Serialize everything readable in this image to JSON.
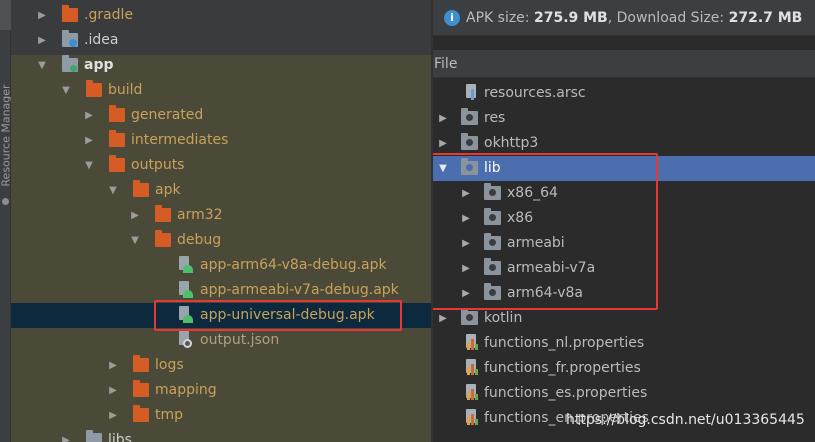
{
  "side_tool": {
    "label": "Resource Manager"
  },
  "project_tree": [
    {
      "label": ".gradle",
      "depth": 1,
      "expanded": false,
      "icon": "folder-icon"
    },
    {
      "label": ".idea",
      "depth": 1,
      "expanded": false,
      "icon": "idea-folder-icon"
    },
    {
      "label": "app",
      "depth": 1,
      "expanded": true,
      "icon": "module-folder-icon"
    },
    {
      "label": "build",
      "depth": 2,
      "expanded": true,
      "icon": "folder-icon"
    },
    {
      "label": "generated",
      "depth": 3,
      "expanded": false,
      "icon": "folder-icon"
    },
    {
      "label": "intermediates",
      "depth": 3,
      "expanded": false,
      "icon": "folder-icon"
    },
    {
      "label": "outputs",
      "depth": 3,
      "expanded": true,
      "icon": "folder-icon"
    },
    {
      "label": "apk",
      "depth": 4,
      "expanded": true,
      "icon": "folder-icon"
    },
    {
      "label": "arm32",
      "depth": 5,
      "expanded": false,
      "icon": "folder-icon"
    },
    {
      "label": "debug",
      "depth": 5,
      "expanded": true,
      "icon": "folder-icon"
    },
    {
      "label": "app-arm64-v8a-debug.apk",
      "depth": 6,
      "icon": "apk-file-icon"
    },
    {
      "label": "app-armeabi-v7a-debug.apk",
      "depth": 6,
      "icon": "apk-file-icon"
    },
    {
      "label": "app-universal-debug.apk",
      "depth": 6,
      "icon": "apk-file-icon",
      "selected": true
    },
    {
      "label": "output.json",
      "depth": 6,
      "icon": "json-file-icon"
    },
    {
      "label": "logs",
      "depth": 4,
      "expanded": false,
      "icon": "folder-icon"
    },
    {
      "label": "mapping",
      "depth": 4,
      "expanded": false,
      "icon": "folder-icon"
    },
    {
      "label": "tmp",
      "depth": 4,
      "expanded": false,
      "icon": "folder-icon"
    },
    {
      "label": "libs",
      "depth": 2,
      "expanded": false,
      "icon": "folder-icon"
    }
  ],
  "apk_analyzer": {
    "apk_size_label": "APK size:",
    "apk_size_value": "275.9 MB",
    "download_size_label": "Download Size:",
    "download_size_value": "272.7 MB",
    "separator": ",",
    "column_header": "File",
    "entries": [
      {
        "label": "resources.arsc",
        "depth": 1,
        "icon": "resource-file-icon"
      },
      {
        "label": "res",
        "depth": 1,
        "expanded": false,
        "icon": "folder-icon"
      },
      {
        "label": "okhttp3",
        "depth": 1,
        "expanded": false,
        "icon": "folder-icon"
      },
      {
        "label": "lib",
        "depth": 1,
        "expanded": true,
        "icon": "folder-icon",
        "selected": true
      },
      {
        "label": "x86_64",
        "depth": 2,
        "expanded": false,
        "icon": "folder-icon"
      },
      {
        "label": "x86",
        "depth": 2,
        "expanded": false,
        "icon": "folder-icon"
      },
      {
        "label": "armeabi",
        "depth": 2,
        "expanded": false,
        "icon": "folder-icon"
      },
      {
        "label": "armeabi-v7a",
        "depth": 2,
        "expanded": false,
        "icon": "folder-icon"
      },
      {
        "label": "arm64-v8a",
        "depth": 2,
        "expanded": false,
        "icon": "folder-icon"
      },
      {
        "label": "kotlin",
        "depth": 1,
        "expanded": false,
        "icon": "folder-icon"
      },
      {
        "label": "functions_nl.properties",
        "depth": 1,
        "icon": "properties-file-icon"
      },
      {
        "label": "functions_fr.properties",
        "depth": 1,
        "icon": "properties-file-icon"
      },
      {
        "label": "functions_es.properties",
        "depth": 1,
        "icon": "properties-file-icon"
      },
      {
        "label": "functions_en.properties",
        "depth": 1,
        "icon": "properties-file-icon"
      }
    ]
  },
  "watermark": "https://blog.csdn.net/u013365445",
  "colors": {
    "tree_background": "#4b4a39",
    "selection_dark": "#0d293e",
    "selection_blue": "#4b6eaf",
    "folder_orange": "#d55c24",
    "highlight_red": "#e53935",
    "info_blue": "#3d8fd1"
  }
}
